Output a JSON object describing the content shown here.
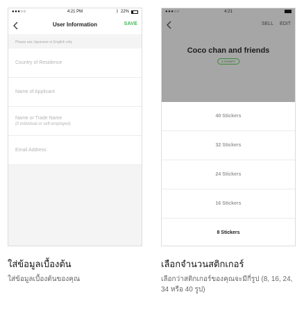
{
  "left": {
    "status": {
      "carrier": "●●●○○",
      "time": "4:21 PM",
      "battery_text": "22%"
    },
    "title": "User Information",
    "save": "SAVE",
    "hint": "Please use Japanese or English only",
    "fields": {
      "country": "Country of Residence",
      "applicant": "Name of Applicant",
      "trade_name": "Name or Trade Name",
      "trade_name_sub": "(if individual or self-employed)",
      "email": "Email Address"
    }
  },
  "right": {
    "status": {
      "carrier": "●●●○○",
      "time": "4:21"
    },
    "actions": {
      "sell": "SELL",
      "edit": "EDIT"
    },
    "set_title": "Coco chan and friends",
    "badge": "8 STAMPS",
    "options": [
      "40 Stickers",
      "32 Stickers",
      "24 Stickers",
      "16 Stickers",
      "8 Stickers"
    ],
    "selected_option": "8 Stickers"
  },
  "captions": {
    "left_title": "ใส่ข้อมูลเบื้องต้น",
    "left_desc": "ใส่ข้อมูลเบื้องต้นของคุณ",
    "right_title": "เลือกจำนวนสติกเกอร์",
    "right_desc": "เลือกว่าสติกเกอร์ของคุณจะมีกี่รูป (8, 16, 24, 34 หรือ 40 รูป)"
  },
  "colors": {
    "accent": "#3aba52",
    "hero_bg": "#a6a6a6"
  },
  "icons": {
    "back": "chevron-left-icon",
    "battery": "battery-icon",
    "bluetooth": "bluetooth-icon"
  }
}
